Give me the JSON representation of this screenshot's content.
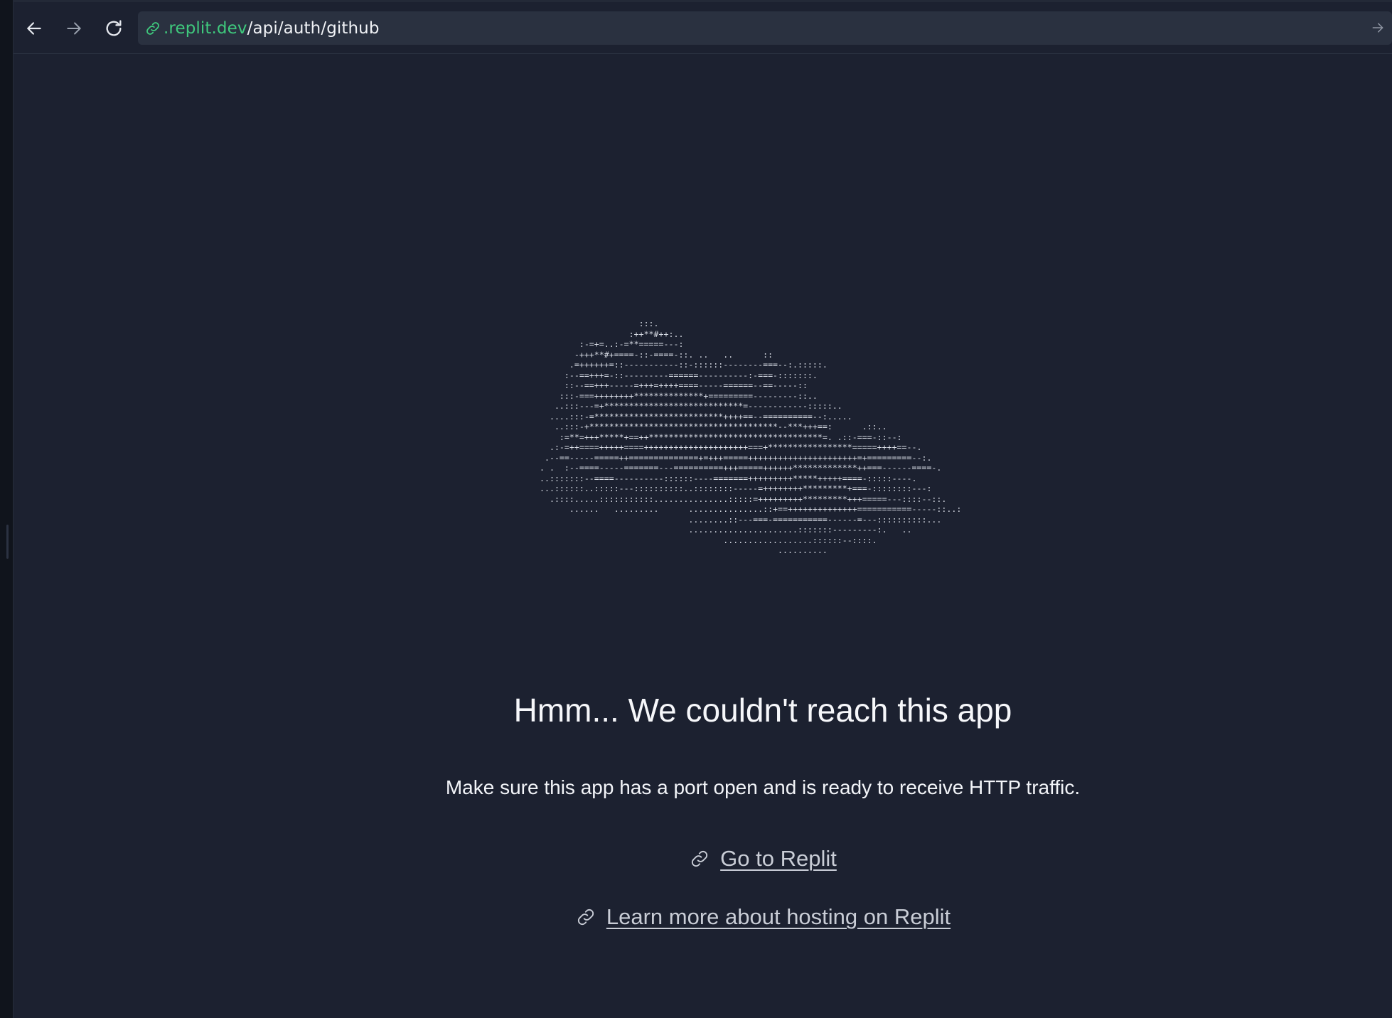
{
  "browser": {
    "back_icon": "arrow-left-icon",
    "forward_icon": "arrow-right-icon",
    "reload_icon": "reload-icon",
    "url_icon": "link-icon",
    "url_domain": ".replit.dev",
    "url_path": "/api/auth/github",
    "go_icon": "arrow-right-icon"
  },
  "page": {
    "ascii_art": "                    :::.\n                  :++**#++:..\n        :-=+=..:-=**=====---:\n       -+++**#+====-::-====-::. ..   ..      ::\n      .=++++++=::-----------::-::::::--------===--:.:::::.\n     :--==+++=-::---------======----------:-===-:::::::.\n     ::--==+++-----=+++=++++====-----======--==-----::\n    :::-===++++++++**************+=========---------::..\n   ..:::---=+****************************=------------:::::..\n  ....:::-=**************************++++==--==========--:.....\n   ..:::-+**************************************--***+++==:      .::..\n    :=**=+++*****+==++***********************************=. .::-===-::--:\n  .:-=++====+++++====+++++++++++++++++++++===+*****************=====++++==--.\n .--==-----=====++==============+=+++=====++++++++++++++++++++++=+=========--:.\n. .  :--====-----=======---==========+++=====++++++*************++===------====-.\n..:::::::--====----------::::::----=======+++++++++*****+++++====-:::::----.\n...::::::..:::::---::::::::::..::::::::-----=++++++++*********+===-::::::::---:\n  .::::.....:::::::::::...............:::::=+++++++++*********+++=====---::::--::.\n      ......   .........      ...............::+==++++++++++++++===========-----::..:\n                              ........::---===-===========------=---::::::::::...\n                              ......................:::::::---------:.   ..\n                                     ..................::::::--::::.\n                                                ..........",
    "heading": "Hmm... We couldn't reach this app",
    "subtext": "Make sure this app has a port open and is ready to receive HTTP traffic.",
    "links": [
      {
        "label": "Go to Replit",
        "icon": "link-icon"
      },
      {
        "label": "Learn more about hosting on Replit",
        "icon": "link-icon"
      }
    ]
  },
  "colors": {
    "background": "#1c2130",
    "url_bar": "#2a3140",
    "domain_green": "#3fc97d",
    "link_gray": "#c9cdd6"
  }
}
